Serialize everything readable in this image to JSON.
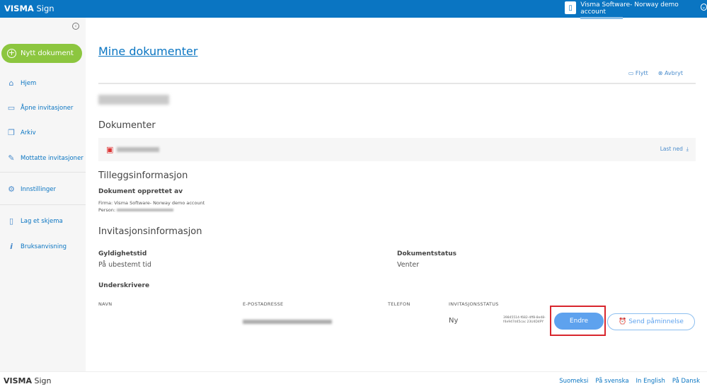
{
  "header": {
    "brand": "VISMA",
    "brand_suffix": "Sign",
    "account_name": "Visma Software- Norway demo account"
  },
  "sidebar": {
    "new_document": "Nytt dokument",
    "items": [
      {
        "label": "Hjem",
        "icon": "home-icon"
      },
      {
        "label": "Åpne invitasjoner",
        "icon": "folder-icon"
      },
      {
        "label": "Arkiv",
        "icon": "archive-icon"
      },
      {
        "label": "Mottatte invitasjoner",
        "icon": "edit-icon"
      },
      {
        "label": "Innstillinger",
        "icon": "gear-icon"
      },
      {
        "label": "Lag et skjema",
        "icon": "file-icon"
      },
      {
        "label": "Bruksanvisning",
        "icon": "info-icon"
      }
    ]
  },
  "main": {
    "title": "Mine dokumenter",
    "move": "Flytt",
    "cancel": "Avbryt",
    "documents_heading": "Dokumenter",
    "download": "Last ned",
    "extra_heading": "Tilleggsinformasjon",
    "created_by": "Dokument opprettet av",
    "company": "Firma: Visma Software- Norway demo account",
    "person_label": "Person:",
    "invitation_heading": "Invitasjonsinformasjon",
    "validity_label": "Gyldighetstid",
    "validity_value": "På ubestemt tid",
    "status_label": "Dokumentstatus",
    "status_value": "Venter",
    "signers_heading": "Underskrivere",
    "columns": [
      "NAVN",
      "E-POSTADRESSE",
      "TELEFON",
      "INVITASJONSSTATUS"
    ],
    "signer": {
      "status": "Ny",
      "id": "39845514-f682-4ff8-8e48-f4e947d45cac 23U4D4PY"
    },
    "edit": "Endre",
    "remind": "Send påminnelse"
  },
  "footer": {
    "brand": "VISMA",
    "brand_suffix": "Sign",
    "languages": [
      "Suomeksi",
      "På svenska",
      "In English",
      "På Dansk"
    ]
  }
}
